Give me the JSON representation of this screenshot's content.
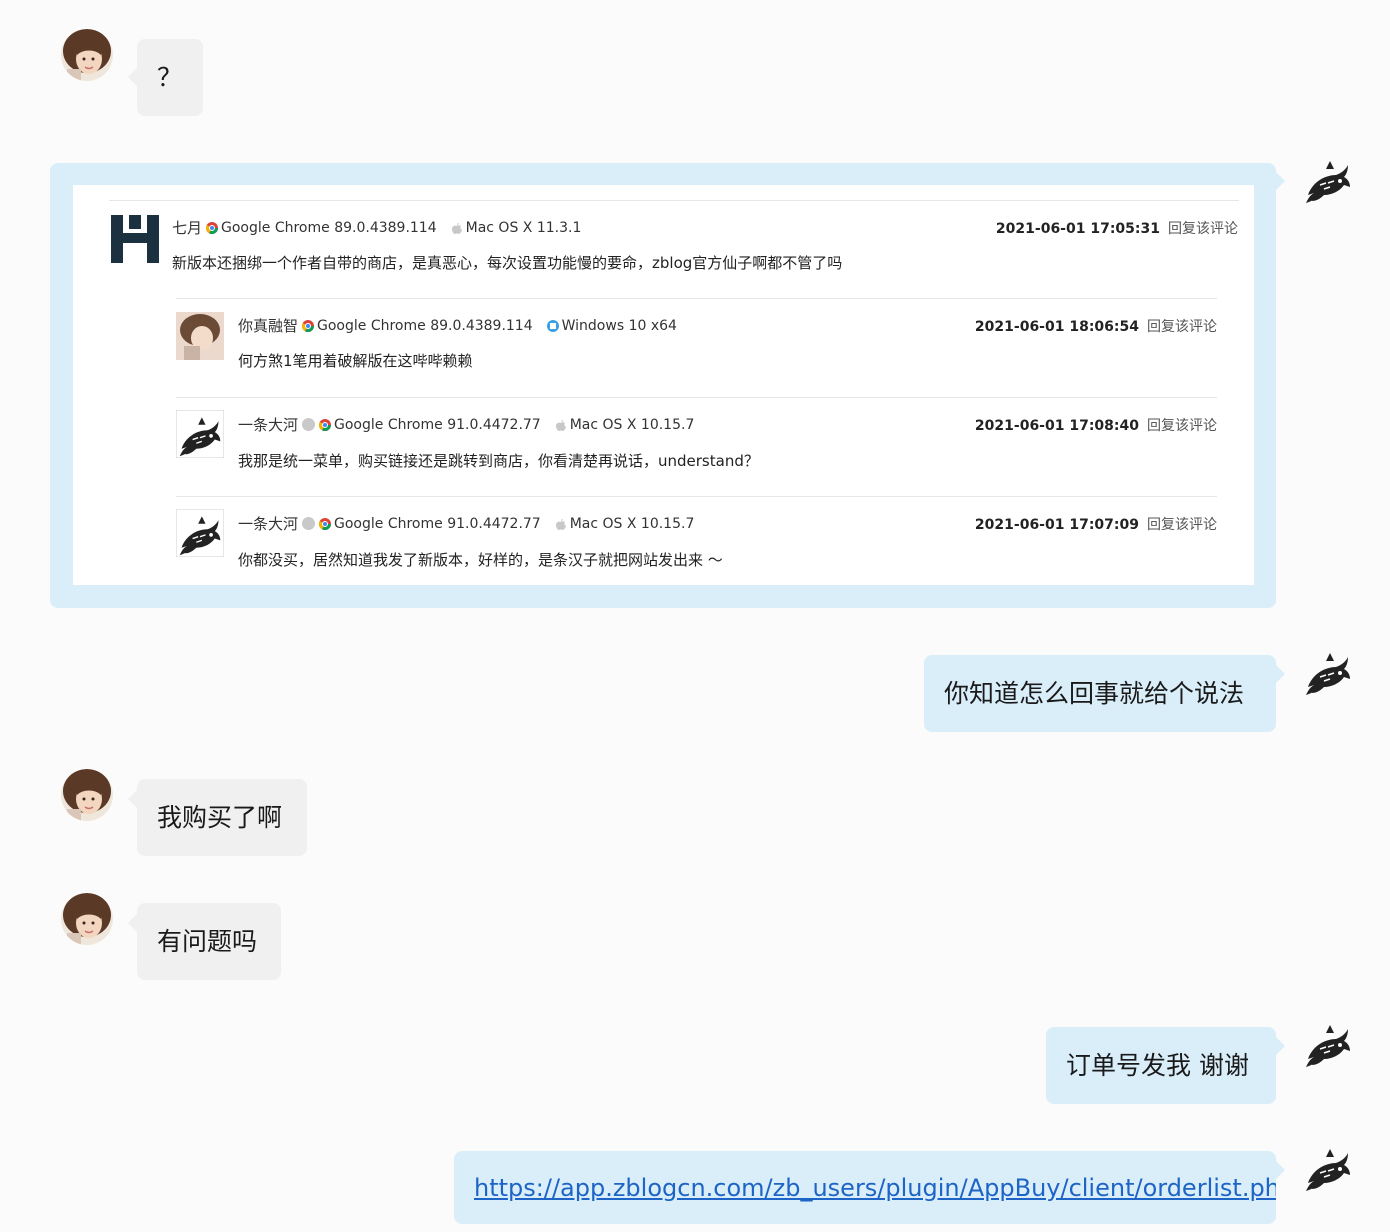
{
  "messages": {
    "m1": {
      "text": "？"
    },
    "m3": {
      "text": "你知道怎么回事就给个说法"
    },
    "m4": {
      "text": "我购买了啊"
    },
    "m5": {
      "text": "有问题吗"
    },
    "m6": {
      "text": "订单号发我 谢谢"
    },
    "m7": {
      "text": "https://app.zblogcn.com/zb_users/plugin/AppBuy/client/orderlist.php"
    }
  },
  "comments": [
    {
      "name": "七月",
      "browser": "Google Chrome 89.0.4389.114",
      "os": "Mac OS X 11.3.1",
      "date": "2021-06-01 17:05:31",
      "reply": "回复该评论",
      "text": "新版本还捆绑一个作者自带的商店，是真恶心，每次设置功能慢的要命，zblog官方仙子啊都不管了吗"
    },
    {
      "name": "你真融智",
      "browser": "Google Chrome 89.0.4389.114",
      "os": "Windows 10 x64",
      "date": "2021-06-01 18:06:54",
      "reply": "回复该评论",
      "text": "何方煞1笔用着破解版在这哔哔赖赖"
    },
    {
      "name": "一条大河",
      "browser": "Google Chrome 91.0.4472.77",
      "os": "Mac OS X 10.15.7",
      "date": "2021-06-01 17:08:40",
      "reply": "回复该评论",
      "text": "我那是统一菜单，购买链接还是跳转到商店，你看清楚再说话，understand？"
    },
    {
      "name": "一条大河",
      "browser": "Google Chrome 91.0.4472.77",
      "os": "Mac OS X 10.15.7",
      "date": "2021-06-01 17:07:09",
      "reply": "回复该评论",
      "text": "你都没买，居然知道我发了新版本，好样的，是条汉子就把网站发出来 ～"
    }
  ],
  "icons": {
    "girl_avatar": "user-avatar-photo",
    "fish_avatar": "fish-avatar",
    "chrome": "chrome-icon",
    "apple": "apple-icon",
    "windows": "windows-icon"
  },
  "colors": {
    "page_bg": "#fbfbfb",
    "bubble_left": "#f0f0f0",
    "bubble_right": "#daeefa",
    "link": "#1d64c6"
  }
}
